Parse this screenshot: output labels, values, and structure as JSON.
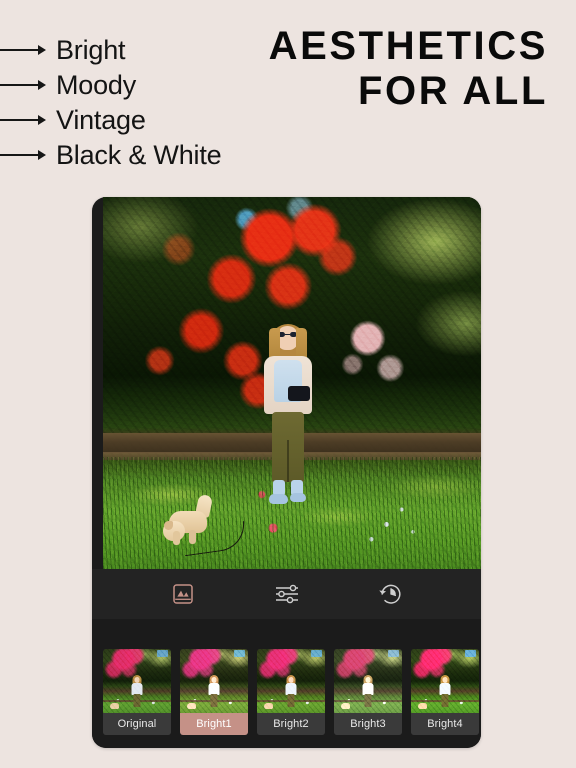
{
  "promo": {
    "background_color": "#ede4e0",
    "headline_lines": [
      "AESTHETICS",
      "FOR ALL"
    ],
    "features": [
      {
        "label": "Bright",
        "icon": "arrow-right-icon"
      },
      {
        "label": "Moody",
        "icon": "arrow-right-icon"
      },
      {
        "label": "Vintage",
        "icon": "arrow-right-icon"
      },
      {
        "label": "Black & White",
        "icon": "arrow-right-icon"
      }
    ]
  },
  "app": {
    "frame_color": "#1b1b1b",
    "toolbar_color": "#232323",
    "accent_color": "#c59187",
    "photo": {
      "alt": "Woman in olive trousers and blue shoes standing on lawn under red rhododendron blossoms with a small cream dog on a leash"
    },
    "toolbar": {
      "tools": [
        {
          "name": "filters-tool",
          "icon": "photo-icon",
          "label": "Filters",
          "active": true
        },
        {
          "name": "adjust-tool",
          "icon": "sliders-icon",
          "label": "Adjust",
          "active": false
        },
        {
          "name": "history-tool",
          "icon": "history-clock-icon",
          "label": "History",
          "active": false
        }
      ]
    },
    "filters": {
      "selected": "Bright1",
      "items": [
        {
          "label": "Original",
          "selected": false,
          "divider_after": true
        },
        {
          "label": "Bright1",
          "selected": true,
          "divider_after": false
        },
        {
          "label": "Bright2",
          "selected": false,
          "divider_after": false
        },
        {
          "label": "Bright3",
          "selected": false,
          "divider_after": false
        },
        {
          "label": "Bright4",
          "selected": false,
          "divider_after": false
        },
        {
          "label": "",
          "selected": false,
          "divider_after": false
        }
      ]
    }
  }
}
